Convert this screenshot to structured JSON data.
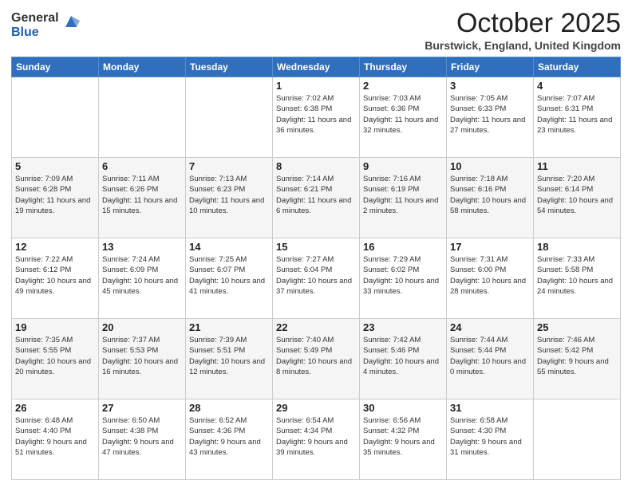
{
  "logo": {
    "general": "General",
    "blue": "Blue"
  },
  "header": {
    "month": "October 2025",
    "location": "Burstwick, England, United Kingdom"
  },
  "weekdays": [
    "Sunday",
    "Monday",
    "Tuesday",
    "Wednesday",
    "Thursday",
    "Friday",
    "Saturday"
  ],
  "weeks": [
    [
      {
        "day": "",
        "info": ""
      },
      {
        "day": "",
        "info": ""
      },
      {
        "day": "",
        "info": ""
      },
      {
        "day": "1",
        "info": "Sunrise: 7:02 AM\nSunset: 6:38 PM\nDaylight: 11 hours and 36 minutes."
      },
      {
        "day": "2",
        "info": "Sunrise: 7:03 AM\nSunset: 6:36 PM\nDaylight: 11 hours and 32 minutes."
      },
      {
        "day": "3",
        "info": "Sunrise: 7:05 AM\nSunset: 6:33 PM\nDaylight: 11 hours and 27 minutes."
      },
      {
        "day": "4",
        "info": "Sunrise: 7:07 AM\nSunset: 6:31 PM\nDaylight: 11 hours and 23 minutes."
      }
    ],
    [
      {
        "day": "5",
        "info": "Sunrise: 7:09 AM\nSunset: 6:28 PM\nDaylight: 11 hours and 19 minutes."
      },
      {
        "day": "6",
        "info": "Sunrise: 7:11 AM\nSunset: 6:26 PM\nDaylight: 11 hours and 15 minutes."
      },
      {
        "day": "7",
        "info": "Sunrise: 7:13 AM\nSunset: 6:23 PM\nDaylight: 11 hours and 10 minutes."
      },
      {
        "day": "8",
        "info": "Sunrise: 7:14 AM\nSunset: 6:21 PM\nDaylight: 11 hours and 6 minutes."
      },
      {
        "day": "9",
        "info": "Sunrise: 7:16 AM\nSunset: 6:19 PM\nDaylight: 11 hours and 2 minutes."
      },
      {
        "day": "10",
        "info": "Sunrise: 7:18 AM\nSunset: 6:16 PM\nDaylight: 10 hours and 58 minutes."
      },
      {
        "day": "11",
        "info": "Sunrise: 7:20 AM\nSunset: 6:14 PM\nDaylight: 10 hours and 54 minutes."
      }
    ],
    [
      {
        "day": "12",
        "info": "Sunrise: 7:22 AM\nSunset: 6:12 PM\nDaylight: 10 hours and 49 minutes."
      },
      {
        "day": "13",
        "info": "Sunrise: 7:24 AM\nSunset: 6:09 PM\nDaylight: 10 hours and 45 minutes."
      },
      {
        "day": "14",
        "info": "Sunrise: 7:25 AM\nSunset: 6:07 PM\nDaylight: 10 hours and 41 minutes."
      },
      {
        "day": "15",
        "info": "Sunrise: 7:27 AM\nSunset: 6:04 PM\nDaylight: 10 hours and 37 minutes."
      },
      {
        "day": "16",
        "info": "Sunrise: 7:29 AM\nSunset: 6:02 PM\nDaylight: 10 hours and 33 minutes."
      },
      {
        "day": "17",
        "info": "Sunrise: 7:31 AM\nSunset: 6:00 PM\nDaylight: 10 hours and 28 minutes."
      },
      {
        "day": "18",
        "info": "Sunrise: 7:33 AM\nSunset: 5:58 PM\nDaylight: 10 hours and 24 minutes."
      }
    ],
    [
      {
        "day": "19",
        "info": "Sunrise: 7:35 AM\nSunset: 5:55 PM\nDaylight: 10 hours and 20 minutes."
      },
      {
        "day": "20",
        "info": "Sunrise: 7:37 AM\nSunset: 5:53 PM\nDaylight: 10 hours and 16 minutes."
      },
      {
        "day": "21",
        "info": "Sunrise: 7:39 AM\nSunset: 5:51 PM\nDaylight: 10 hours and 12 minutes."
      },
      {
        "day": "22",
        "info": "Sunrise: 7:40 AM\nSunset: 5:49 PM\nDaylight: 10 hours and 8 minutes."
      },
      {
        "day": "23",
        "info": "Sunrise: 7:42 AM\nSunset: 5:46 PM\nDaylight: 10 hours and 4 minutes."
      },
      {
        "day": "24",
        "info": "Sunrise: 7:44 AM\nSunset: 5:44 PM\nDaylight: 10 hours and 0 minutes."
      },
      {
        "day": "25",
        "info": "Sunrise: 7:46 AM\nSunset: 5:42 PM\nDaylight: 9 hours and 55 minutes."
      }
    ],
    [
      {
        "day": "26",
        "info": "Sunrise: 6:48 AM\nSunset: 4:40 PM\nDaylight: 9 hours and 51 minutes."
      },
      {
        "day": "27",
        "info": "Sunrise: 6:50 AM\nSunset: 4:38 PM\nDaylight: 9 hours and 47 minutes."
      },
      {
        "day": "28",
        "info": "Sunrise: 6:52 AM\nSunset: 4:36 PM\nDaylight: 9 hours and 43 minutes."
      },
      {
        "day": "29",
        "info": "Sunrise: 6:54 AM\nSunset: 4:34 PM\nDaylight: 9 hours and 39 minutes."
      },
      {
        "day": "30",
        "info": "Sunrise: 6:56 AM\nSunset: 4:32 PM\nDaylight: 9 hours and 35 minutes."
      },
      {
        "day": "31",
        "info": "Sunrise: 6:58 AM\nSunset: 4:30 PM\nDaylight: 9 hours and 31 minutes."
      },
      {
        "day": "",
        "info": ""
      }
    ]
  ]
}
